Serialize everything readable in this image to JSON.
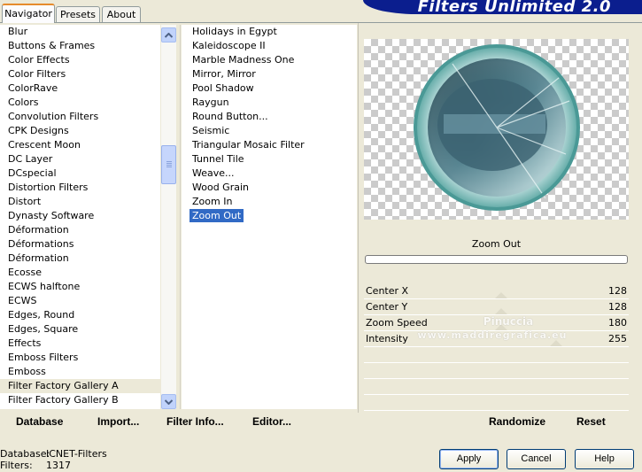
{
  "tabs": {
    "navigator": "Navigator",
    "presets": "Presets",
    "about": "About"
  },
  "banner": {
    "title": "Filters Unlimited 2.0"
  },
  "categories": [
    "Blur",
    "Buttons & Frames",
    "Color Effects",
    "Color Filters",
    "ColorRave",
    "Colors",
    "Convolution Filters",
    "CPK Designs",
    "Crescent Moon",
    "DC Layer",
    "DCspecial",
    "Distortion Filters",
    "Distort",
    "Dynasty Software",
    "Déformation",
    "Déformations",
    "Déformation",
    "Ecosse",
    "ECWS halftone",
    "ECWS",
    "Edges, Round",
    "Edges, Square",
    "Effects",
    "Emboss Filters",
    "Emboss",
    "Filter Factory Gallery A",
    "Filter Factory Gallery B"
  ],
  "selected_category": "Filter Factory Gallery A",
  "filters": [
    "Holidays in Egypt",
    "Kaleidoscope II",
    "Marble Madness One",
    "Mirror, Mirror",
    "Pool Shadow",
    "Raygun",
    "Round Button...",
    "Seismic",
    "Triangular Mosaic Filter",
    "Tunnel Tile",
    "Weave...",
    "Wood Grain",
    "Zoom In",
    "Zoom Out"
  ],
  "selected_filter": "Zoom Out",
  "preview": {
    "filter_name": "Zoom Out",
    "progress": 0
  },
  "params": [
    {
      "name": "Center X",
      "value": "128"
    },
    {
      "name": "Center Y",
      "value": "128"
    },
    {
      "name": "Zoom Speed",
      "value": "180"
    },
    {
      "name": "Intensity",
      "value": "255"
    }
  ],
  "watermark": {
    "line1": "Pinuccia",
    "line2": "www.maddiregrafica.eu"
  },
  "toolbar": {
    "database": "Database",
    "import": "Import...",
    "filter_info": "Filter Info...",
    "editor": "Editor...",
    "randomize": "Randomize",
    "reset": "Reset"
  },
  "status": {
    "database_label": "Database:",
    "database_value": "ICNET-Filters",
    "filters_label": "Filters:",
    "filters_value": "1317"
  },
  "dialog": {
    "apply": "Apply",
    "cancel": "Cancel",
    "help": "Help"
  }
}
